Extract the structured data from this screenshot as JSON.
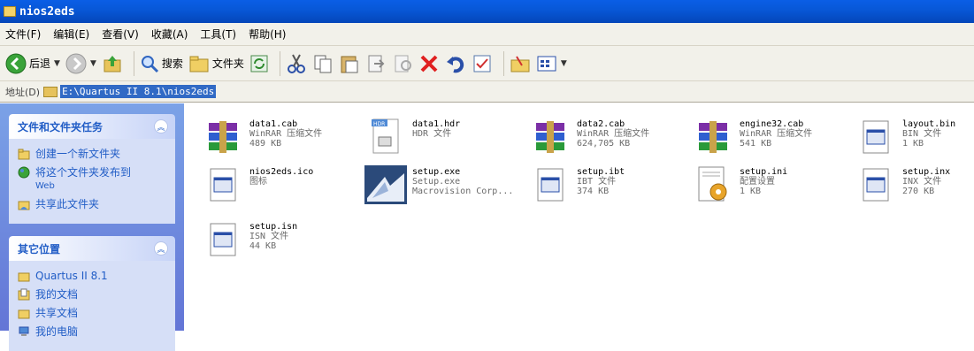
{
  "window": {
    "title": "nios2eds"
  },
  "menu": [
    "文件(F)",
    "编辑(E)",
    "查看(V)",
    "收藏(A)",
    "工具(T)",
    "帮助(H)"
  ],
  "toolbar": {
    "back_label": "后退",
    "search_label": "搜索",
    "folders_label": "文件夹"
  },
  "address": {
    "label": "地址(D)",
    "path": "E:\\Quartus II 8.1\\nios2eds"
  },
  "sidebar": {
    "tasks": {
      "title": "文件和文件夹任务",
      "items": [
        {
          "label": "创建一个新文件夹",
          "icon": "new-folder-icon"
        },
        {
          "label": "将这个文件夹发布到",
          "sub": "Web",
          "icon": "publish-web-icon"
        },
        {
          "label": "共享此文件夹",
          "icon": "share-folder-icon"
        }
      ]
    },
    "places": {
      "title": "其它位置",
      "items": [
        {
          "label": "Quartus II 8.1",
          "icon": "folder-icon"
        },
        {
          "label": "我的文档",
          "icon": "my-documents-icon"
        },
        {
          "label": "共享文档",
          "icon": "shared-documents-icon"
        },
        {
          "label": "我的电脑",
          "icon": "my-computer-icon"
        }
      ]
    }
  },
  "files": [
    {
      "name": "data1.cab",
      "type": "WinRAR 压缩文件",
      "size": "489 KB",
      "icon": "winrar-archive-icon"
    },
    {
      "name": "data1.hdr",
      "type": "HDR 文件",
      "size": "",
      "icon": "hdr-file-icon"
    },
    {
      "name": "data2.cab",
      "type": "WinRAR 压缩文件",
      "size": "624,705 KB",
      "icon": "winrar-archive-icon"
    },
    {
      "name": "engine32.cab",
      "type": "WinRAR 压缩文件",
      "size": "541 KB",
      "icon": "winrar-archive-icon"
    },
    {
      "name": "layout.bin",
      "type": "BIN 文件",
      "size": "1 KB",
      "icon": "generic-file-icon"
    },
    {
      "name": "nios2eds.ico",
      "type": "图标",
      "size": "",
      "icon": "generic-file-icon"
    },
    {
      "name": "setup.exe",
      "type": "Setup.exe",
      "size": "Macrovision Corp...",
      "icon": "installer-icon"
    },
    {
      "name": "setup.ibt",
      "type": "IBT 文件",
      "size": "374 KB",
      "icon": "generic-file-icon"
    },
    {
      "name": "setup.ini",
      "type": "配置设置",
      "size": "1 KB",
      "icon": "config-settings-icon"
    },
    {
      "name": "setup.inx",
      "type": "INX 文件",
      "size": "270 KB",
      "icon": "generic-file-icon"
    },
    {
      "name": "setup.isn",
      "type": "ISN 文件",
      "size": "44 KB",
      "icon": "generic-file-icon"
    }
  ]
}
